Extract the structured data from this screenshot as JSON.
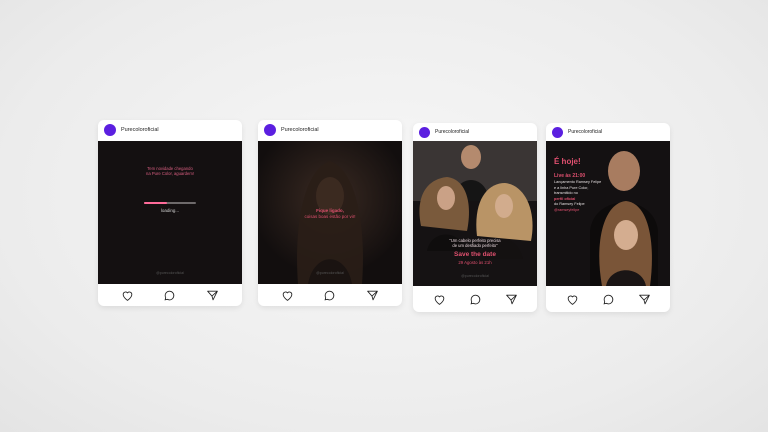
{
  "account": {
    "handle": "Purecoloroficial",
    "avatar_color": "#5b1fe0"
  },
  "posts": [
    {
      "caption_lines": [
        "Tem novidade chegando",
        "na Pure Color, aguardem!"
      ],
      "loading_label": "loading...",
      "progress": 0.45,
      "watermark": "@purecoloroficial"
    },
    {
      "caption_lines": [
        "Fique ligado,",
        "coisas boas estão por vir!"
      ],
      "watermark": "@purecoloroficial"
    },
    {
      "quote_lines": [
        "\"Um cabelo perfeito precisa",
        "de um desfiado perfeito\""
      ],
      "title": "Save the date",
      "date": "29 Agosto às 21h",
      "watermark": "@purecoloroficial"
    },
    {
      "heading": "É hoje!",
      "lines": [
        "Live às 21:00",
        "Lançamento Ramsey Felipe",
        "e a linha Pure Color,",
        "transmitido no",
        "perfil oficial",
        "do Ramsey Felipe",
        "@ramseyfelipe"
      ]
    }
  ],
  "colors": {
    "accent": "#e0506f",
    "dark": "#130f10"
  },
  "icons": [
    "heart-icon",
    "comment-icon",
    "share-icon"
  ]
}
